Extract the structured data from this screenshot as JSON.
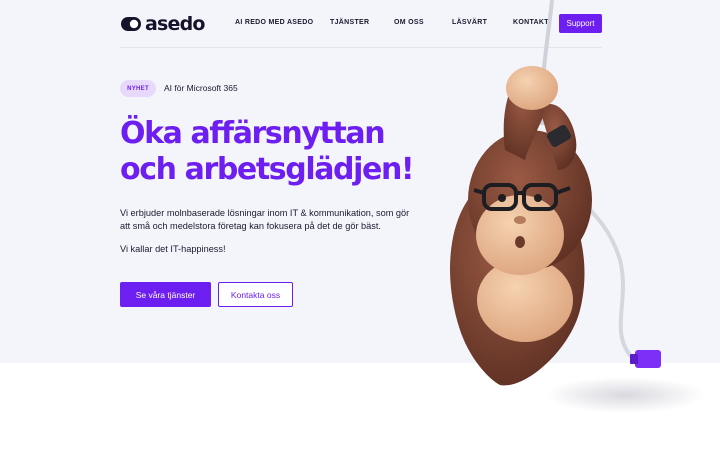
{
  "brand": {
    "name": "asedo"
  },
  "nav": {
    "items": [
      {
        "label": "AI REDO MED ASEDO"
      },
      {
        "label": "TJÄNSTER"
      },
      {
        "label": "OM OSS"
      },
      {
        "label": "LÄSVÄRT"
      },
      {
        "label": "KONTAKT"
      }
    ],
    "support_label": "Support"
  },
  "hero": {
    "badge": "NYHET",
    "badge_text": "AI för Microsoft 365",
    "headline_line1": "Öka affärsnyttan",
    "headline_line2": "och arbetsglädjen!",
    "lead": "Vi erbjuder molnbaserade lösningar inom IT & kommunikation, som gör att små och medelstora företag kan fokusera på det de gör bäst.",
    "tagline": "Vi kallar det IT-happiness!",
    "primary_cta": "Se våra tjänster",
    "secondary_cta": "Kontakta oss"
  },
  "colors": {
    "accent": "#6d1ef0",
    "hero_background": "#f4f5fb",
    "badge_background": "#e6d9fb",
    "text": "#1a1a2e"
  },
  "icons": {
    "logo_mark": "asedo-logo-mark",
    "mascot": "monkey-mascot-hanging-from-cable"
  }
}
